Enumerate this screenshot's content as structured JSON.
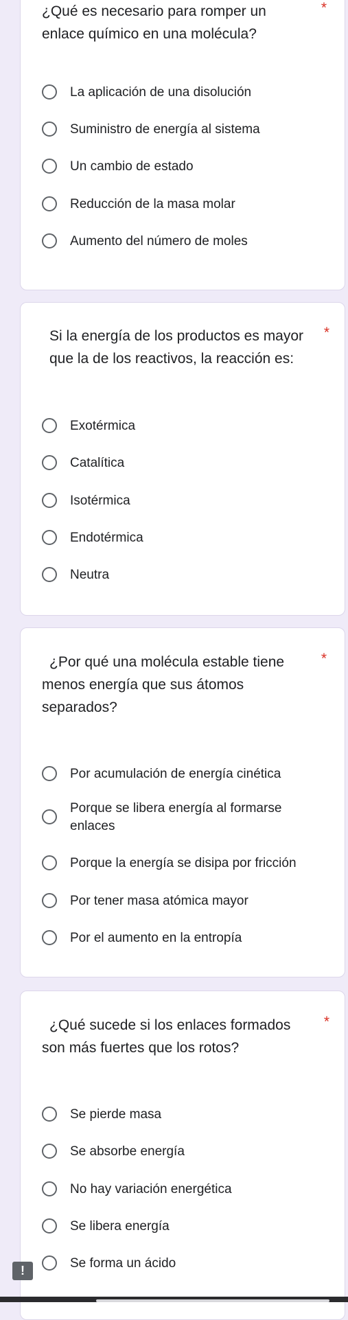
{
  "questions": [
    {
      "text": "¿Qué es necesario para romper un enlace químico en una molécula?",
      "required_marker": "*",
      "options": [
        "La aplicación de una disolución",
        "Suministro de energía al sistema",
        "Un cambio de estado",
        "Reducción de la masa molar",
        "Aumento del número de moles"
      ]
    },
    {
      "text": "Si la energía de los productos es mayor que la de los reactivos, la reacción es:",
      "required_marker": "*",
      "options": [
        "Exotérmica",
        "Catalítica",
        "Isotérmica",
        "Endotérmica",
        "Neutra"
      ]
    },
    {
      "text": "¿Por qué una molécula estable tiene menos energía que sus átomos separados?",
      "required_marker": "*",
      "options": [
        "Por acumulación de energía cinética",
        "Porque se libera energía al formarse enlaces",
        "Porque la energía se disipa por fricción",
        "Por tener masa atómica mayor",
        "Por el aumento en la entropía"
      ]
    },
    {
      "text": "¿Qué sucede si los enlaces formados son más fuertes que los rotos?",
      "required_marker": "*",
      "options": [
        "Se pierde masa",
        "Se absorbe energía",
        "No hay variación energética",
        "Se libera energía",
        "Se forma un ácido"
      ]
    }
  ],
  "report_button": {
    "icon": "exclamation-icon",
    "glyph": "!"
  },
  "colors": {
    "background": "#efebf8",
    "card": "#ffffff",
    "required_star": "#d93025",
    "radio_border": "#5f6368"
  }
}
